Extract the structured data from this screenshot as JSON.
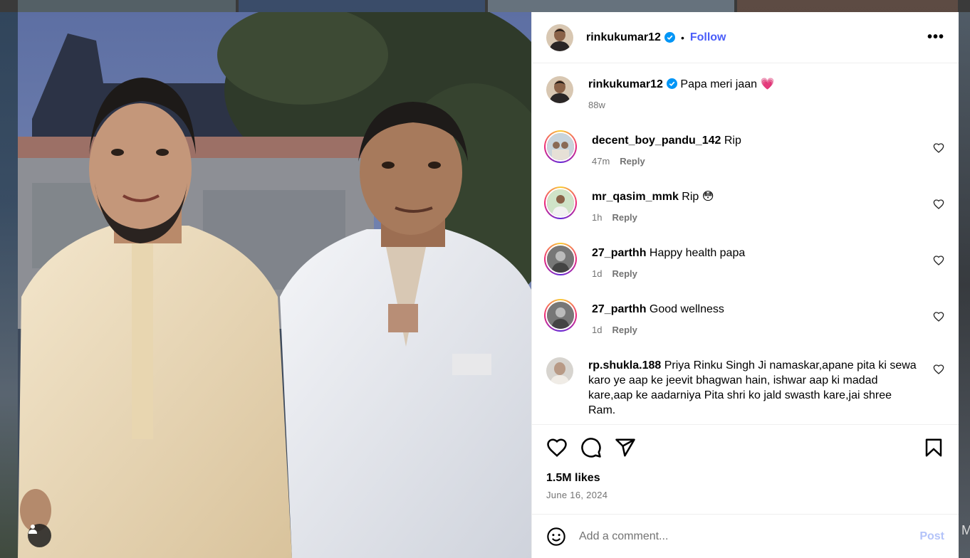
{
  "post": {
    "username": "rinkukumar12",
    "follow_label": "Follow",
    "dot": "•",
    "more_label": "•••",
    "caption_text": "Papa meri jaan",
    "caption_emoji": "💗",
    "caption_age": "88w"
  },
  "comments": [
    {
      "user": "decent_boy_pandu_142",
      "text": "Rip",
      "age": "47m",
      "reply": "Reply"
    },
    {
      "user": "mr_qasim_mmk",
      "text": "Rip 😳",
      "age": "1h",
      "reply": "Reply"
    },
    {
      "user": "27_parthh",
      "text": "Happy health papa",
      "age": "1d",
      "reply": "Reply"
    },
    {
      "user": "27_parthh",
      "text": "Good wellness",
      "age": "1d",
      "reply": "Reply"
    },
    {
      "user": "rp.shukla.188",
      "text": "Priya Rinku Singh Ji namaskar,apane pita ki sewa karo ye aap ke jeevit bhagwan hain, ishwar aap ki madad kare,aap ke aadarniya Pita shri ko jald swasth kare,jai shree Ram."
    }
  ],
  "engagement": {
    "likes": "1.5M likes",
    "date": "June 16, 2024"
  },
  "add_comment": {
    "placeholder": "Add a comment...",
    "post_label": "Post"
  },
  "background": {
    "edge_letter": "M"
  },
  "colors": {
    "follow": "#4a5df9",
    "verified": "#0095f6",
    "post_disabled": "#b3c3f9",
    "muted": "#737373"
  },
  "icons": [
    "verified-badge-icon",
    "more-options-icon",
    "like-icon",
    "comment-icon",
    "share-icon",
    "bookmark-icon",
    "emoji-icon",
    "person-tag-icon"
  ]
}
